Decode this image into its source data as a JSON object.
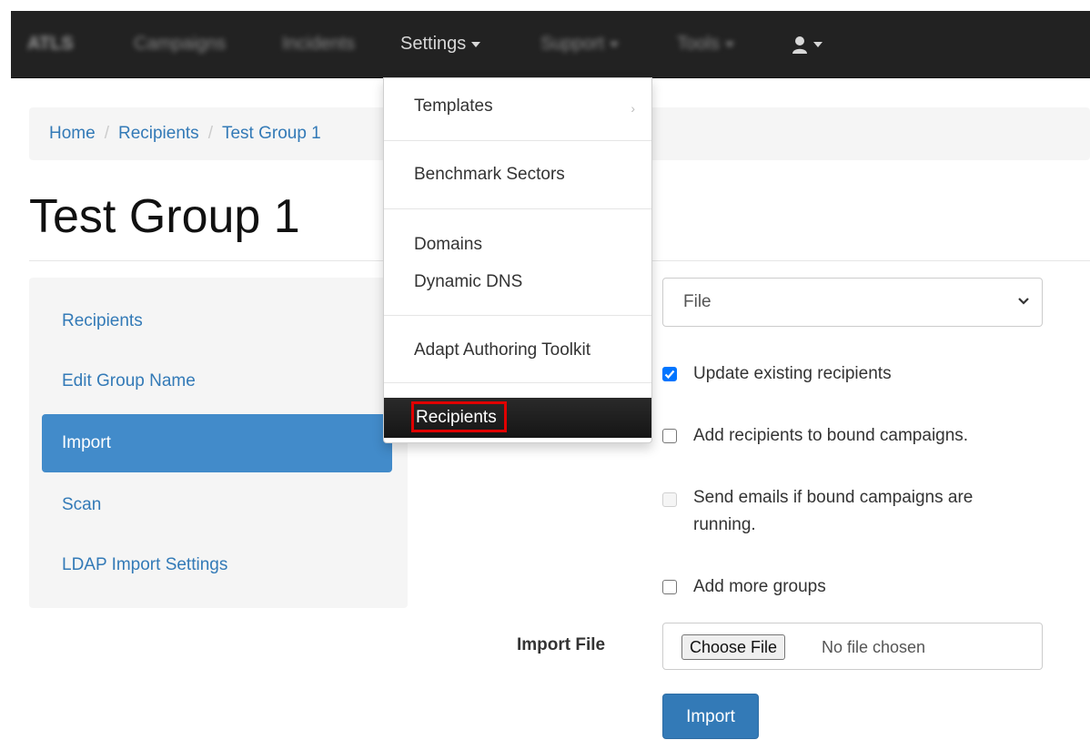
{
  "navbar": {
    "brand": "ATLS",
    "items": [
      "Campaigns",
      "Incidents",
      "Settings",
      "Support",
      "Tools"
    ]
  },
  "breadcrumb": [
    "Home",
    "Recipients",
    "Test Group 1"
  ],
  "page_title": "Test Group 1",
  "side_nav": [
    "Recipients",
    "Edit Group Name",
    "Import",
    "Scan",
    "LDAP Import Settings"
  ],
  "form": {
    "source_select": "File",
    "checkboxes": {
      "update_existing": "Update existing recipients",
      "add_bound": "Add recipients to bound campaigns.",
      "send_emails": "Send emails if bound campaigns are running.",
      "add_groups": "Add more groups"
    },
    "import_file_label": "Import File",
    "choose_file": "Choose File",
    "no_file": "No file chosen",
    "import_button": "Import"
  },
  "settings_menu": {
    "templates": "Templates",
    "benchmark": "Benchmark Sectors",
    "domains": "Domains",
    "dynamic_dns": "Dynamic DNS",
    "adapt": "Adapt Authoring Toolkit",
    "recipients": "Recipients"
  },
  "colors": {
    "navbar": "#222222",
    "link": "#337ab7",
    "active_nav": "#428bca",
    "highlight": "#e00000"
  }
}
